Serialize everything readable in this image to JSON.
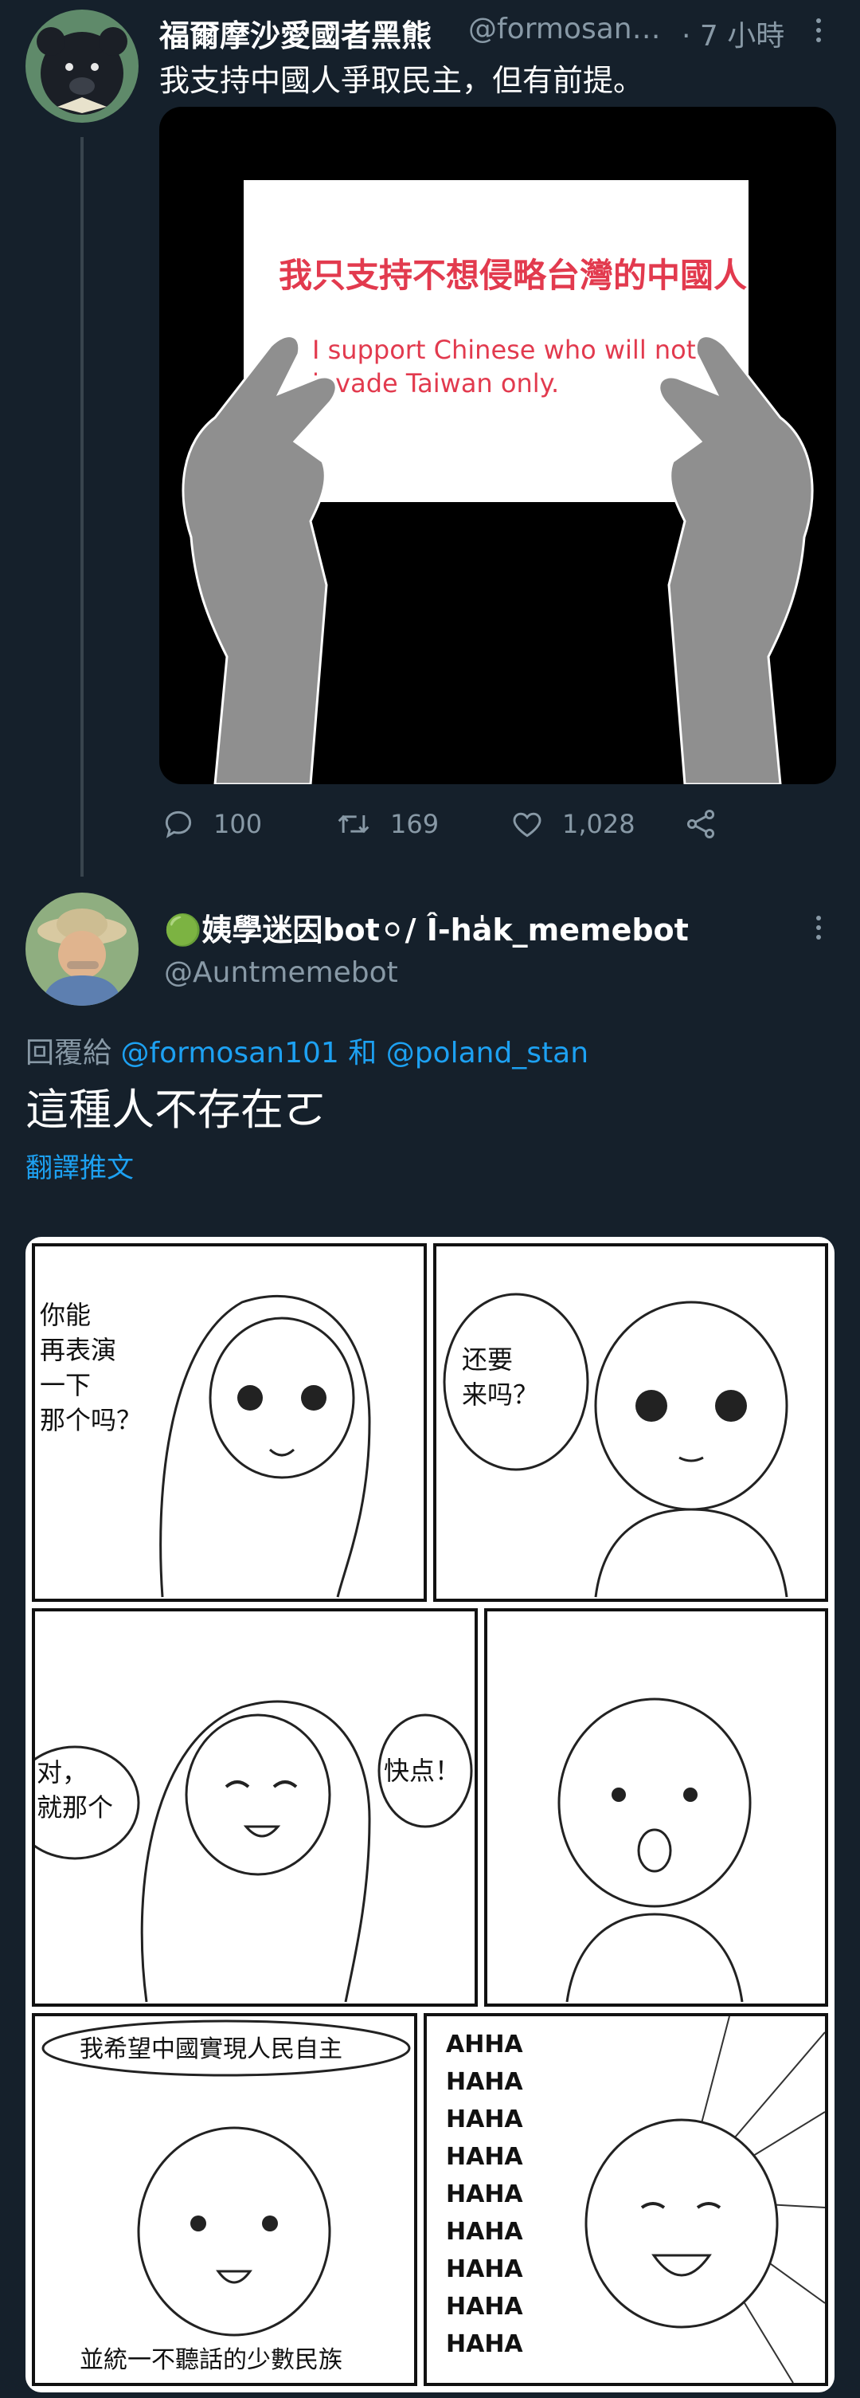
{
  "tweet1": {
    "display_name": "福爾摩沙愛國者黑熊",
    "handle": "@formosan…",
    "time": "· 7 小時",
    "text": "我支持中國人爭取民主，但有前提。",
    "image": {
      "zh": "我只支持不想侵略台灣的中國人",
      "en": "I support Chinese who will not\ninvade Taiwan only."
    },
    "actions": {
      "replies": "100",
      "retweets": "169",
      "likes": "1,028"
    }
  },
  "tweet2": {
    "display_name": "🟢姨學迷因bot⚪/ Î-ha̍k_memebot",
    "handle": "@Auntmemebot",
    "reply_prefix": "回覆給",
    "reply_to_1": "@formosan101",
    "reply_and": "和",
    "reply_to_2": "@poland_stan",
    "text": "這種人不存在ㄛ",
    "translate": "翻譯推文",
    "comic": {
      "p1": "你能\n再表演\n一下\n那个吗？",
      "p2": "还要\n来吗？",
      "p3": "对，\n就那个",
      "p4": "快点！",
      "p5_top": "我希望中國實現人民自主",
      "p5_bottom": "並統一不聽話的少數民族",
      "p6": "AHHA\nHAHA\nHAHA\nHAHA\nHAHA\nHAHA\nHAHA\nHAHA\nHAHA"
    }
  },
  "colors": {
    "background": "#15202b",
    "secondary": "#8899a6",
    "link": "#1da1f2",
    "sign_red": "#e23a4e"
  }
}
